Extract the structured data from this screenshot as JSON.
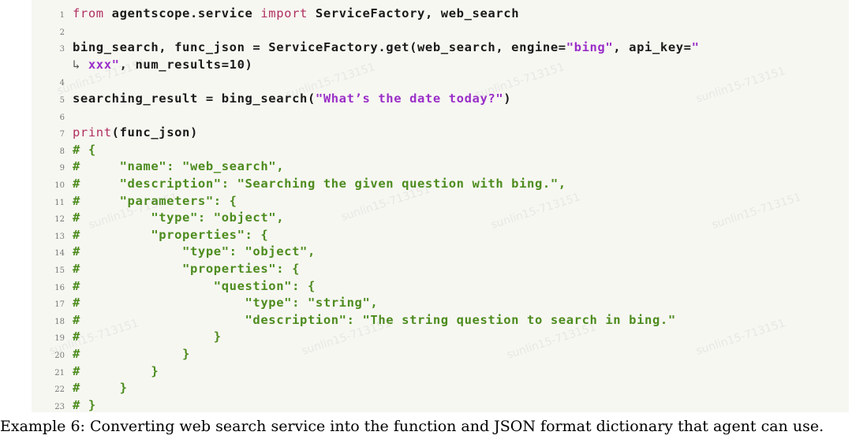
{
  "code": {
    "lines": [
      {
        "num": "1",
        "parts": [
          {
            "t": "from",
            "c": "kw"
          },
          {
            "t": " agentscope.service ",
            "c": ""
          },
          {
            "t": "import",
            "c": "kw"
          },
          {
            "t": " ServiceFactory, web_search",
            "c": ""
          }
        ]
      },
      {
        "num": "2",
        "parts": []
      },
      {
        "num": "3",
        "parts": [
          {
            "t": "bing_search, func_json = ServiceFactory.get(web_search, engine=",
            "c": ""
          },
          {
            "t": "\"bing\"",
            "c": "str"
          },
          {
            "t": ", api_key=",
            "c": ""
          },
          {
            "t": "\"",
            "c": "str"
          }
        ]
      },
      {
        "num": "",
        "parts": [
          {
            "t": "↳ ",
            "c": "wrap"
          },
          {
            "t": "xxx\"",
            "c": "str"
          },
          {
            "t": ", num_results=10)",
            "c": ""
          }
        ]
      },
      {
        "num": "4",
        "parts": []
      },
      {
        "num": "5",
        "parts": [
          {
            "t": "searching_result = bing_search(",
            "c": ""
          },
          {
            "t": "\"What’s the date today?\"",
            "c": "str"
          },
          {
            "t": ")",
            "c": ""
          }
        ]
      },
      {
        "num": "6",
        "parts": []
      },
      {
        "num": "7",
        "parts": [
          {
            "t": "print",
            "c": "fn"
          },
          {
            "t": "(func_json)",
            "c": ""
          }
        ]
      },
      {
        "num": "8",
        "parts": [
          {
            "t": "# {",
            "c": "cmt"
          }
        ]
      },
      {
        "num": "9",
        "parts": [
          {
            "t": "#     \"name\": \"web_search\",",
            "c": "cmt"
          }
        ]
      },
      {
        "num": "10",
        "parts": [
          {
            "t": "#     \"description\": \"Searching the given question with bing.\",",
            "c": "cmt"
          }
        ]
      },
      {
        "num": "11",
        "parts": [
          {
            "t": "#     \"parameters\": {",
            "c": "cmt"
          }
        ]
      },
      {
        "num": "12",
        "parts": [
          {
            "t": "#         \"type\": \"object\",",
            "c": "cmt"
          }
        ]
      },
      {
        "num": "13",
        "parts": [
          {
            "t": "#         \"properties\": {",
            "c": "cmt"
          }
        ]
      },
      {
        "num": "14",
        "parts": [
          {
            "t": "#             \"type\": \"object\",",
            "c": "cmt"
          }
        ]
      },
      {
        "num": "15",
        "parts": [
          {
            "t": "#             \"properties\": {",
            "c": "cmt"
          }
        ]
      },
      {
        "num": "16",
        "parts": [
          {
            "t": "#                 \"question\": {",
            "c": "cmt"
          }
        ]
      },
      {
        "num": "17",
        "parts": [
          {
            "t": "#                     \"type\": \"string\",",
            "c": "cmt"
          }
        ]
      },
      {
        "num": "18",
        "parts": [
          {
            "t": "#                     \"description\": \"The string question to search in bing.\"",
            "c": "cmt"
          }
        ]
      },
      {
        "num": "19",
        "parts": [
          {
            "t": "#                 }",
            "c": "cmt"
          }
        ]
      },
      {
        "num": "20",
        "parts": [
          {
            "t": "#             }",
            "c": "cmt"
          }
        ]
      },
      {
        "num": "21",
        "parts": [
          {
            "t": "#         }",
            "c": "cmt"
          }
        ]
      },
      {
        "num": "22",
        "parts": [
          {
            "t": "#     }",
            "c": "cmt"
          }
        ]
      },
      {
        "num": "23",
        "parts": [
          {
            "t": "# }",
            "c": "cmt"
          }
        ]
      }
    ]
  },
  "caption": "Example 6: Converting web search service into the function and JSON format dictionary that agent can use.",
  "watermark": {
    "text": "sunlin15-713151"
  },
  "colors": {
    "keyword": "#b03060",
    "string": "#9a2fc8",
    "comment": "#4d8c1e",
    "code_background": "#f7f7f2"
  }
}
